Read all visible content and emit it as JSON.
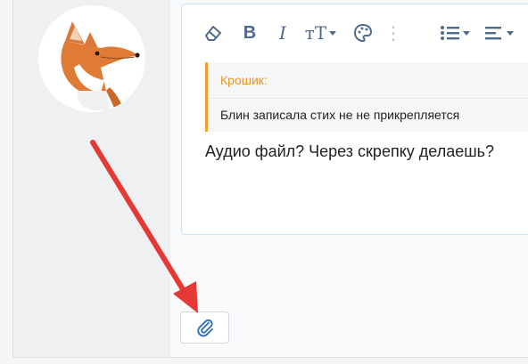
{
  "avatar": {
    "icon": "fox-avatar-icon"
  },
  "toolbar": {
    "buttons": [
      {
        "name": "eraser-icon",
        "glyph": "⌫"
      },
      {
        "name": "bold-icon",
        "glyph": "B"
      },
      {
        "name": "italic-icon",
        "glyph": "I"
      },
      {
        "name": "font-size-icon",
        "glyph": "тT"
      },
      {
        "name": "palette-icon",
        "glyph": "🎨"
      },
      {
        "name": "more-icon",
        "glyph": "⋮"
      },
      {
        "name": "list-icon",
        "glyph": "≡"
      },
      {
        "name": "align-icon",
        "glyph": "≡"
      }
    ]
  },
  "quote": {
    "author": "Крошик:",
    "text": "Блин записала стих не не прикрепляется"
  },
  "message": {
    "text": "Аудио файл? Через скрепку делаешь?"
  },
  "attach_button": {
    "icon": "paperclip-icon"
  },
  "colors": {
    "accent": "#4f6b8c",
    "quote_border": "#f0a030",
    "quote_author": "#e8951f",
    "arrow": "#e53935",
    "paperclip": "#2f6fb0"
  }
}
